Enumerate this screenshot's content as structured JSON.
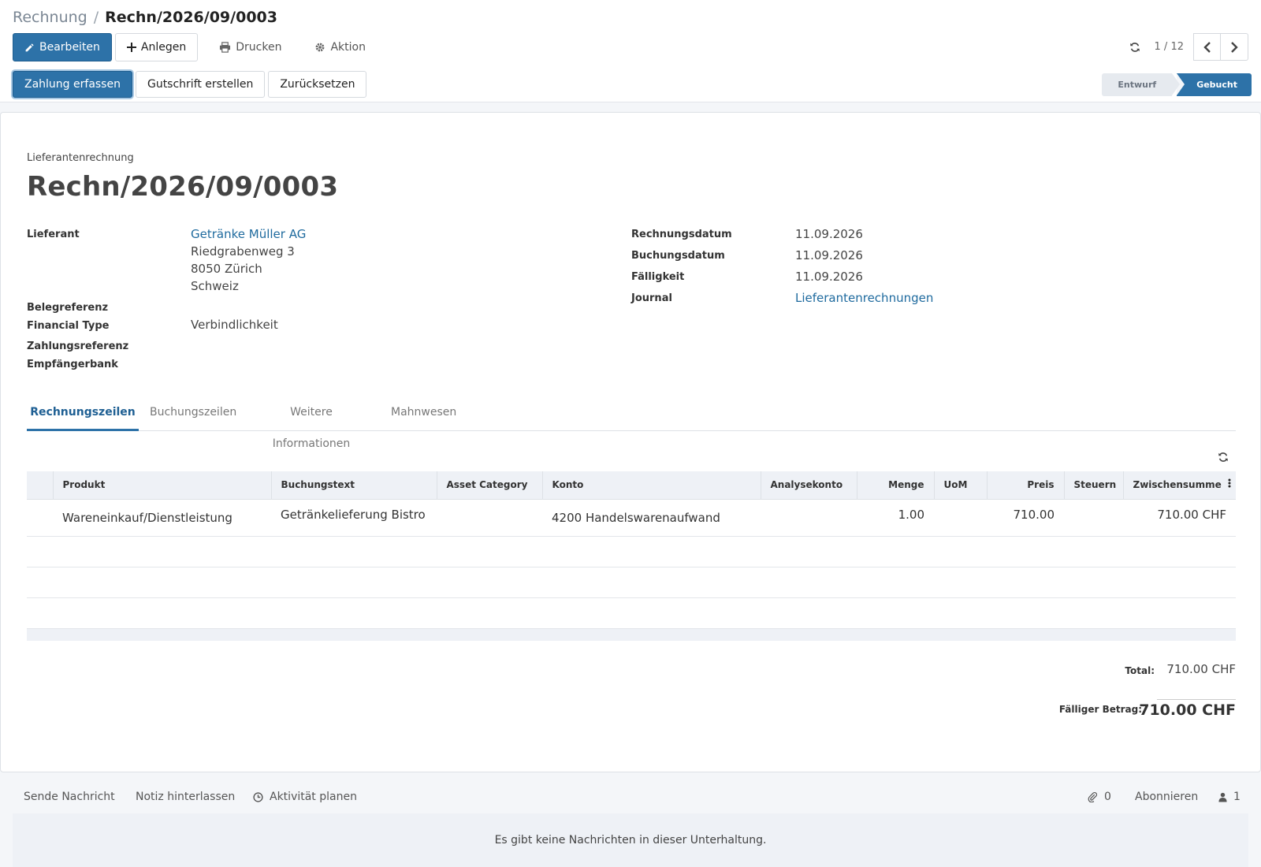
{
  "breadcrumb": {
    "parent": "Rechnung",
    "separator": "/",
    "current": "Rechn/2026/09/0003"
  },
  "toolbar": {
    "edit_label": "Bearbeiten",
    "create_label": "Anlegen",
    "print_label": "Drucken",
    "action_label": "Aktion"
  },
  "pager": {
    "value": "1 / 12"
  },
  "actions": {
    "register_payment": "Zahlung erfassen",
    "credit_note": "Gutschrift erstellen",
    "reset": "Zurücksetzen"
  },
  "status": {
    "draft": "Entwurf",
    "posted": "Gebucht",
    "active": "posted"
  },
  "document": {
    "type": "Lieferantenrechnung",
    "title": "Rechn/2026/09/0003"
  },
  "left_fields": {
    "vendor_label": "Lieferant",
    "vendor_name": "Getränke Müller AG",
    "vendor_street": "Riedgrabenweg 3",
    "vendor_city": "8050 Zürich",
    "vendor_country": "Schweiz",
    "reference_label": "Belegreferenz",
    "financial_type_label": "Financial Type",
    "financial_type_value": "Verbindlichkeit",
    "payment_ref_label": "Zahlungsreferenz",
    "bank_label": "Empfängerbank"
  },
  "right_fields": {
    "invoice_date_label": "Rechnungsdatum",
    "invoice_date": "11.09.2026",
    "accounting_date_label": "Buchungsdatum",
    "accounting_date": "11.09.2026",
    "due_label": "Fälligkeit",
    "due_date": "11.09.2026",
    "journal_label": "Journal",
    "journal_value": "Lieferantenrechnungen"
  },
  "tabs": [
    "Rechnungszeilen",
    "Buchungszeilen",
    "Weitere Informationen",
    "Mahnwesen"
  ],
  "lines_table": {
    "columns": [
      "Produkt",
      "Buchungstext",
      "Asset Category",
      "Konto",
      "Analysekonto",
      "Menge",
      "UoM",
      "Preis",
      "Steuern",
      "Zwischensumme"
    ],
    "rows": [
      {
        "product": "Wareneinkauf/Dienstleistung",
        "label": "Getränkelieferung Bistro",
        "asset_category": "",
        "account": "4200 Handelswarenaufwand",
        "analytic": "",
        "quantity": "1.00",
        "uom": "",
        "price": "710.00",
        "taxes": "",
        "subtotal": "710.00 CHF"
      }
    ]
  },
  "totals": {
    "total_label": "Total:",
    "total_value": "710.00 CHF",
    "due_label": "Fälliger Betrag:",
    "due_value": "710.00 CHF"
  },
  "chatter": {
    "send_message": "Sende Nachricht",
    "log_note": "Notiz hinterlassen",
    "schedule_activity": "Aktivität planen",
    "attachments_count": "0",
    "follow": "Abonnieren",
    "followers_count": "1",
    "empty_message": "Es gibt keine Nachrichten in dieser Unterhaltung."
  },
  "colors": {
    "primary": "#2d72a8",
    "link": "#1e6a9e",
    "header_bg": "#eef1f6"
  }
}
